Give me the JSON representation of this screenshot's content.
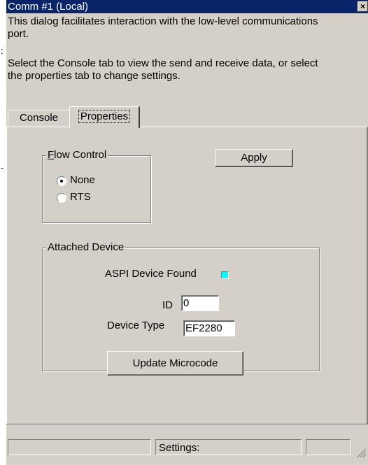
{
  "window": {
    "title": "Comm #1 (Local)",
    "close_glyph": "×"
  },
  "description": {
    "line1": "This dialog facilitates interaction with the low-level communications",
    "line2": "port.",
    "line3": "Select the Console tab to view the send and receive data, or select",
    "line4": "the properties tab to change settings."
  },
  "tabs": [
    {
      "label": "Console",
      "selected": false
    },
    {
      "label": "Properties",
      "selected": true
    }
  ],
  "flow_control": {
    "label_first": "F",
    "label_rest": "low Control",
    "options": [
      {
        "label": "None",
        "selected": true
      },
      {
        "label": "RTS",
        "selected": false
      }
    ]
  },
  "apply_button": "Apply",
  "attached_device": {
    "label": "Attached Device",
    "aspi_label": "ASPI Device Found",
    "aspi_indicator_color": "#00ffff",
    "id_label": "ID",
    "id_value": "0",
    "device_type_label": "Device Type",
    "device_type_value": "EF2280",
    "update_button": "Update Microcode"
  },
  "status_bar": {
    "pane1": "",
    "pane2": "Settings:",
    "pane3": ""
  },
  "colors": {
    "titlebar": "#0a246a",
    "face": "#d4d0c8",
    "shadow": "#808080",
    "highlight": "#ffffff"
  },
  "icons": {
    "close": "close-icon",
    "radio": "radio-icon",
    "resize": "resize-grip-icon"
  }
}
